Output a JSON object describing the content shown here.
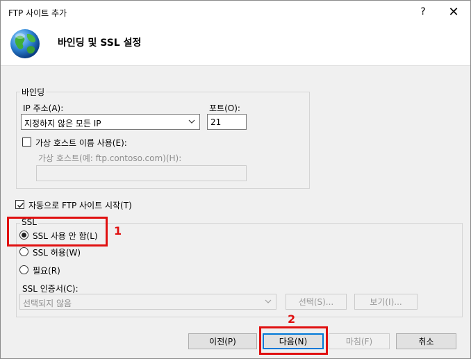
{
  "window": {
    "title": "FTP 사이트 추가",
    "help_symbol": "?",
    "close_symbol": "✕"
  },
  "header": {
    "title": "바인딩 및 SSL 설정",
    "icon": "globe-icon"
  },
  "binding": {
    "group_label": "바인딩",
    "ip_label": "IP 주소(A):",
    "ip_value": "지정하지 않은 모든 IP",
    "port_label": "포트(O):",
    "port_value": "21",
    "virtual_host_checkbox_label": "가상 호스트 이름 사용(E):",
    "virtual_host_checked": false,
    "virtual_host_label": "가상 호스트(예: ftp.contoso.com)(H):",
    "virtual_host_value": ""
  },
  "auto_start": {
    "label": "자동으로 FTP 사이트 시작(T)",
    "checked": true
  },
  "ssl": {
    "group_label": "SSL",
    "options": [
      {
        "label": "SSL 사용 안 함(L)",
        "selected": true
      },
      {
        "label": "SSL 허용(W)",
        "selected": false
      },
      {
        "label": "필요(R)",
        "selected": false
      }
    ],
    "cert_label": "SSL 인증서(C):",
    "cert_value": "선택되지 않음",
    "select_button": "선택(S)...",
    "view_button": "보기(I)..."
  },
  "footer": {
    "prev_button": "이전(P)",
    "next_button": "다음(N)",
    "finish_button": "마침(F)",
    "cancel_button": "취소"
  },
  "annotations": {
    "callout_1": "1",
    "callout_2": "2",
    "color": "#e01010"
  }
}
